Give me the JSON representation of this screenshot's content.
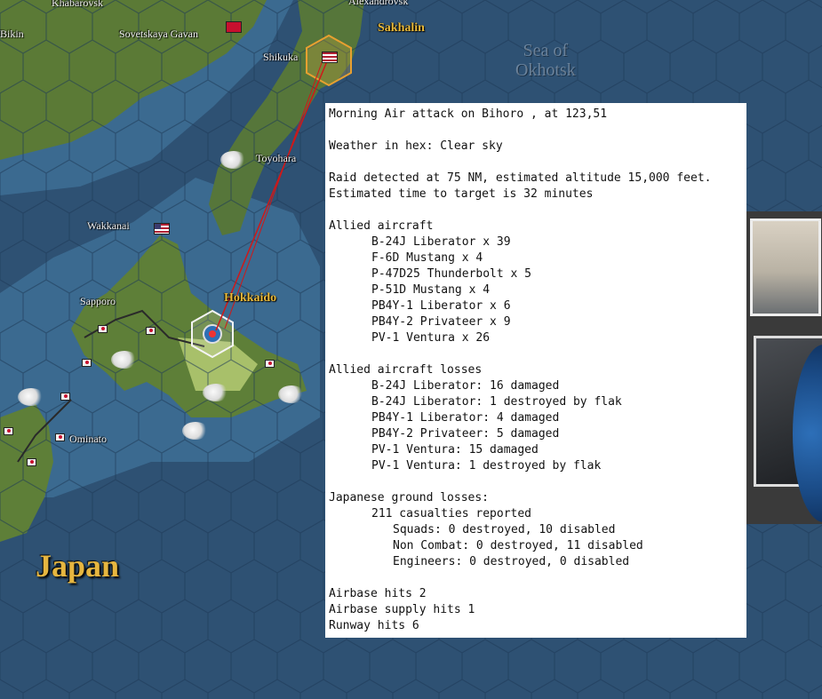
{
  "map": {
    "places": {
      "khabarovsk": "Khabarovsk",
      "bikin": "Bikin",
      "sovetskaya_gavan": "Sovetskaya Gavan",
      "alexandrovsk": "Alexandrovsk",
      "shikuka": "Shikuka",
      "toyohara": "Toyohara",
      "wakkanai": "Wakkanai",
      "sapporo": "Sapporo",
      "ominato": "Ominato"
    },
    "regions": {
      "sakhalin": "Sakhalin",
      "hokkaido": "Hokkaido"
    },
    "sea_line1": "Sea of",
    "sea_line2": "Okhotsk",
    "country": "Japan"
  },
  "report": {
    "title": "Morning Air attack on Bihoro , at 123,51",
    "weather": "Weather in hex: Clear sky",
    "raid_detected": "Raid detected at 75 NM, estimated altitude 15,000 feet.",
    "time_to_target": "Estimated time to target is 32 minutes",
    "allied_aircraft_header": "Allied aircraft",
    "allied_aircraft": [
      "B-24J Liberator x 39",
      "F-6D Mustang x 4",
      "P-47D25 Thunderbolt x 5",
      "P-51D Mustang x 4",
      "PB4Y-1 Liberator x 6",
      "PB4Y-2 Privateer x 9",
      "PV-1 Ventura x 26"
    ],
    "losses_header": "Allied aircraft losses",
    "losses": [
      "B-24J Liberator: 16 damaged",
      "B-24J Liberator: 1 destroyed by flak",
      "PB4Y-1 Liberator: 4 damaged",
      "PB4Y-2 Privateer: 5 damaged",
      "PV-1 Ventura: 15 damaged",
      "PV-1 Ventura: 1 destroyed by flak"
    ],
    "ground_header": "Japanese ground losses:",
    "casualties": "211 casualties reported",
    "ground_details": [
      "Squads: 0 destroyed, 10 disabled",
      "Non Combat: 0 destroyed, 11 disabled",
      "Engineers: 0 destroyed, 0 disabled"
    ],
    "airbase_hits": "Airbase hits 2",
    "airbase_supply_hits": "Airbase supply hits 1",
    "runway_hits": "Runway hits 6"
  },
  "colors": {
    "sea": "#2c4f72",
    "land": "#5b7a36",
    "attack_line": "#d01818",
    "label_region": "#e8b93a"
  }
}
